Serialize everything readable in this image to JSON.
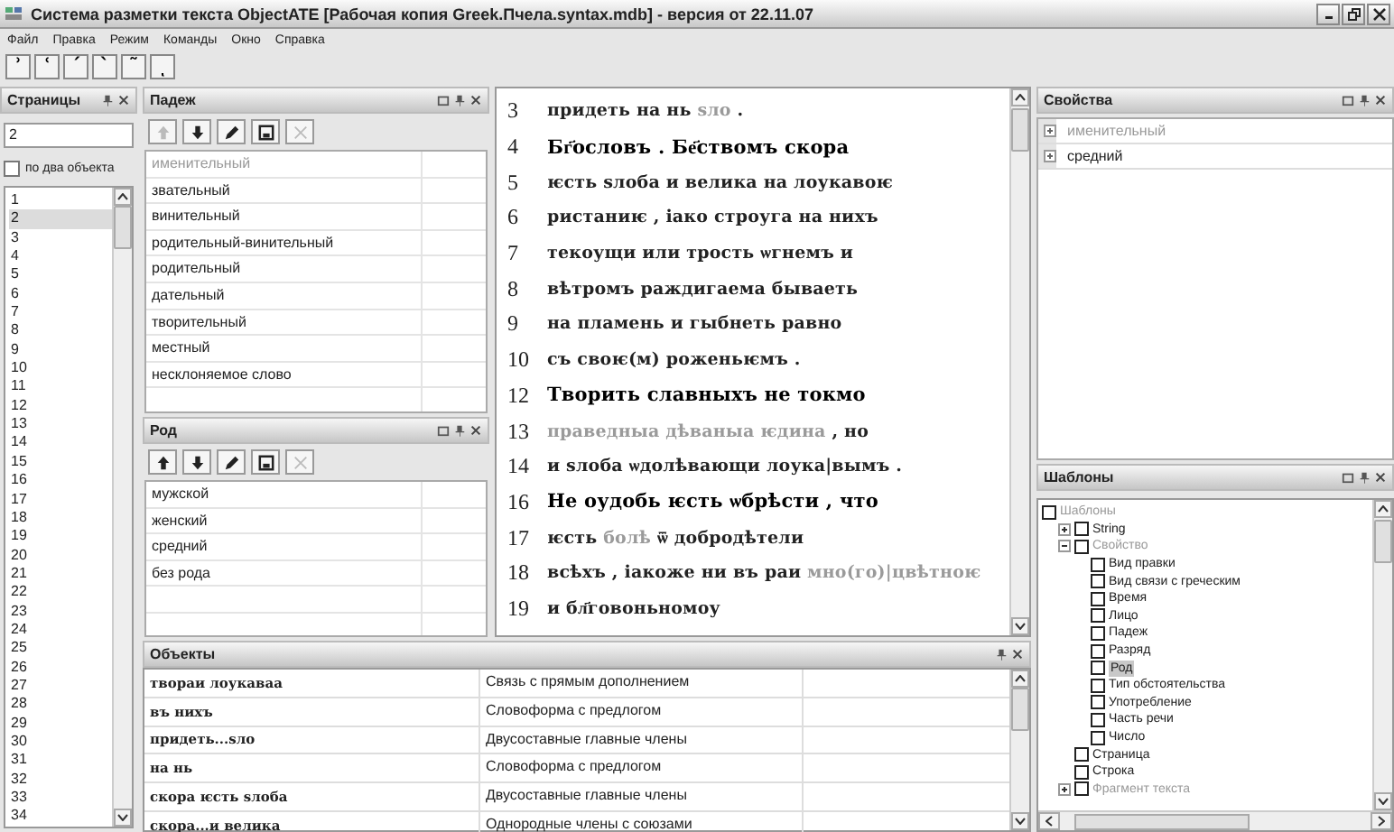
{
  "window": {
    "title": "Система разметки текста ObjectATE [Рабочая копия Greek.Пчела.syntax.mdb] - версия от 22.11.07"
  },
  "menu": [
    "Файл",
    "Правка",
    "Режим",
    "Команды",
    "Окно",
    "Справка"
  ],
  "toolbar": [
    "ʾ",
    "ʿ",
    "ˊ",
    "ˋ",
    "῀",
    "ͺ"
  ],
  "pages": {
    "title": "Страницы",
    "floatable": false,
    "filter": "2",
    "pair_option": {
      "label": "по два объекта",
      "checked": false
    },
    "items": [
      {
        "label": "1",
        "selected": false
      },
      {
        "label": "2",
        "selected": true
      },
      {
        "label": "3",
        "selected": false
      },
      {
        "label": "4",
        "selected": false
      },
      {
        "label": "5",
        "selected": false
      },
      {
        "label": "6",
        "selected": false
      },
      {
        "label": "7",
        "selected": false
      },
      {
        "label": "8",
        "selected": false
      },
      {
        "label": "9",
        "selected": false
      },
      {
        "label": "10",
        "selected": false
      },
      {
        "label": "11",
        "selected": false
      },
      {
        "label": "12",
        "selected": false
      },
      {
        "label": "13",
        "selected": false
      },
      {
        "label": "14",
        "selected": false
      },
      {
        "label": "15",
        "selected": false
      },
      {
        "label": "16",
        "selected": false
      },
      {
        "label": "17",
        "selected": false
      },
      {
        "label": "18",
        "selected": false
      },
      {
        "label": "19",
        "selected": false
      },
      {
        "label": "20",
        "selected": false
      },
      {
        "label": "21",
        "selected": false
      },
      {
        "label": "22",
        "selected": false
      },
      {
        "label": "23",
        "selected": false
      },
      {
        "label": "24",
        "selected": false
      },
      {
        "label": "25",
        "selected": false
      },
      {
        "label": "26",
        "selected": false
      },
      {
        "label": "27",
        "selected": false
      },
      {
        "label": "28",
        "selected": false
      },
      {
        "label": "29",
        "selected": false
      },
      {
        "label": "30",
        "selected": false
      },
      {
        "label": "31",
        "selected": false
      },
      {
        "label": "32",
        "selected": false
      },
      {
        "label": "33",
        "selected": false
      },
      {
        "label": "34",
        "selected": false
      }
    ]
  },
  "case_panel": {
    "title": "Падеж",
    "floatable": true,
    "tools": [
      {
        "kind": "up",
        "disabled": true
      },
      {
        "kind": "down",
        "disabled": false
      },
      {
        "kind": "edit",
        "disabled": false
      },
      {
        "kind": "save",
        "disabled": false
      },
      {
        "kind": "delete",
        "disabled": true
      }
    ],
    "items": [
      {
        "label": "именительный",
        "greyed": true
      },
      {
        "label": "звательный",
        "greyed": false
      },
      {
        "label": "винительный",
        "greyed": false
      },
      {
        "label": "родительный-винительный",
        "greyed": false
      },
      {
        "label": "родительный",
        "greyed": false
      },
      {
        "label": "дательный",
        "greyed": false
      },
      {
        "label": "творительный",
        "greyed": false
      },
      {
        "label": "местный",
        "greyed": false
      },
      {
        "label": "несклоняемое слово",
        "greyed": false
      }
    ]
  },
  "gender_panel": {
    "title": "Род",
    "floatable": true,
    "tools": [
      {
        "kind": "up",
        "disabled": false
      },
      {
        "kind": "down",
        "disabled": false
      },
      {
        "kind": "edit",
        "disabled": false
      },
      {
        "kind": "save",
        "disabled": false
      },
      {
        "kind": "delete",
        "disabled": true
      }
    ],
    "items": [
      {
        "label": "мужской",
        "greyed": false
      },
      {
        "label": "женский",
        "greyed": false
      },
      {
        "label": "средний",
        "greyed": false
      },
      {
        "label": "без рода",
        "greyed": false
      }
    ]
  },
  "editor": {
    "lines": [
      {
        "number": "3",
        "bold": false,
        "segments": [
          {
            "text": "придеть на нь ",
            "greyed": false
          },
          {
            "text": "ѕло",
            "greyed": true
          },
          {
            "text": " .",
            "greyed": false
          }
        ]
      },
      {
        "number": "4",
        "bold": true,
        "segments": [
          {
            "text": "Бг҃ословъ . Бе҃ствомъ скора",
            "greyed": false
          }
        ]
      },
      {
        "number": "5",
        "bold": false,
        "segments": [
          {
            "text": "ѥсть ѕлоба и велика на лоукавоѥ",
            "greyed": false
          }
        ]
      },
      {
        "number": "6",
        "bold": false,
        "segments": [
          {
            "text": "ристаниѥ , іако строуга на нихъ",
            "greyed": false
          }
        ]
      },
      {
        "number": "7",
        "bold": false,
        "segments": [
          {
            "text": "текоущи или трость ѡгнемъ и",
            "greyed": false
          }
        ]
      },
      {
        "number": "8",
        "bold": false,
        "segments": [
          {
            "text": "вѣтромъ раждигаема бываеть",
            "greyed": false
          }
        ]
      },
      {
        "number": "9",
        "bold": false,
        "segments": [
          {
            "text": "на пламень и гыбнеть равно",
            "greyed": false
          }
        ]
      },
      {
        "number": "10",
        "bold": false,
        "segments": [
          {
            "text": "съ своѥ(м) роженьѥмъ .",
            "greyed": false
          }
        ]
      },
      {
        "number": "12",
        "bold": true,
        "segments": [
          {
            "text": "Творить славныхъ не токмо",
            "greyed": false
          }
        ]
      },
      {
        "number": "13",
        "bold": false,
        "segments": [
          {
            "text": "праведныа дѣваныа ѥдина",
            "greyed": true
          },
          {
            "text": " , но",
            "greyed": false
          }
        ]
      },
      {
        "number": "14",
        "bold": false,
        "segments": [
          {
            "text": "и ѕлоба ѡдолѣвающи лоука|вымъ .",
            "greyed": false
          }
        ]
      },
      {
        "number": "16",
        "bold": true,
        "segments": [
          {
            "text": "Не оудобь ѥсть ѡбрѣсти , что",
            "greyed": false
          }
        ]
      },
      {
        "number": "17",
        "bold": false,
        "segments": [
          {
            "text": "ѥсть ",
            "greyed": false
          },
          {
            "text": "болѣ",
            "greyed": true
          },
          {
            "text": " ѿ добродѣтели",
            "greyed": false
          }
        ]
      },
      {
        "number": "18",
        "bold": false,
        "segments": [
          {
            "text": "всѣхъ , іакоже ни въ раи ",
            "greyed": false
          },
          {
            "text": "мно(го)|цвѣтноѥ",
            "greyed": true
          }
        ]
      },
      {
        "number": "19",
        "bold": false,
        "segments": [
          {
            "text": "и бл҃говоньномоу",
            "greyed": false
          }
        ]
      }
    ]
  },
  "objects": {
    "title": "Объекты",
    "floatable": false,
    "rows": [
      {
        "text": "твораи лоукаваа",
        "relation": "Связь с прямым дополнением"
      },
      {
        "text": "въ нихъ",
        "relation": "Словоформа с предлогом"
      },
      {
        "text": "придеть...ѕло",
        "relation": "Двусоставные главные члены"
      },
      {
        "text": "на нь",
        "relation": "Словоформа с предлогом"
      },
      {
        "text": "скора ѥсть ѕлоба",
        "relation": "Двусоставные главные члены"
      },
      {
        "text": "скора...и велика",
        "relation": "Однородные члены с союзами"
      }
    ]
  },
  "properties": {
    "title": "Свойства",
    "floatable": true,
    "rows": [
      {
        "label": "именительный",
        "greyed": true
      },
      {
        "label": "средний",
        "greyed": false
      }
    ]
  },
  "templates": {
    "title": "Шаблоны",
    "floatable": true,
    "tree": [
      {
        "label": "Шаблоны",
        "greyed": true,
        "checked": false,
        "selected": false,
        "children": [
          {
            "label": "String",
            "greyed": false,
            "checked": false,
            "selected": false,
            "expanded": false
          },
          {
            "label": "Свойство",
            "greyed": true,
            "checked": false,
            "selected": false,
            "expanded": true,
            "children": [
              {
                "label": "Вид правки",
                "greyed": false,
                "checked": false,
                "selected": false
              },
              {
                "label": "Вид связи с греческим",
                "greyed": false,
                "checked": false,
                "selected": false
              },
              {
                "label": "Время",
                "greyed": false,
                "checked": false,
                "selected": false
              },
              {
                "label": "Лицо",
                "greyed": false,
                "checked": false,
                "selected": false
              },
              {
                "label": "Падеж",
                "greyed": false,
                "checked": false,
                "selected": false
              },
              {
                "label": "Разряд",
                "greyed": false,
                "checked": false,
                "selected": false
              },
              {
                "label": "Род",
                "greyed": false,
                "checked": false,
                "selected": true
              },
              {
                "label": "Тип обстоятельства",
                "greyed": false,
                "checked": false,
                "selected": false
              },
              {
                "label": "Употребление",
                "greyed": false,
                "checked": false,
                "selected": false
              },
              {
                "label": "Часть речи",
                "greyed": false,
                "checked": false,
                "selected": false
              },
              {
                "label": "Число",
                "greyed": false,
                "checked": false,
                "selected": false
              }
            ]
          },
          {
            "label": "Страница",
            "greyed": false,
            "checked": false,
            "selected": false
          },
          {
            "label": "Строка",
            "greyed": false,
            "checked": false,
            "selected": false
          },
          {
            "label": "Фрагмент текста",
            "greyed": true,
            "checked": false,
            "selected": false,
            "expanded": false
          }
        ]
      }
    ]
  }
}
